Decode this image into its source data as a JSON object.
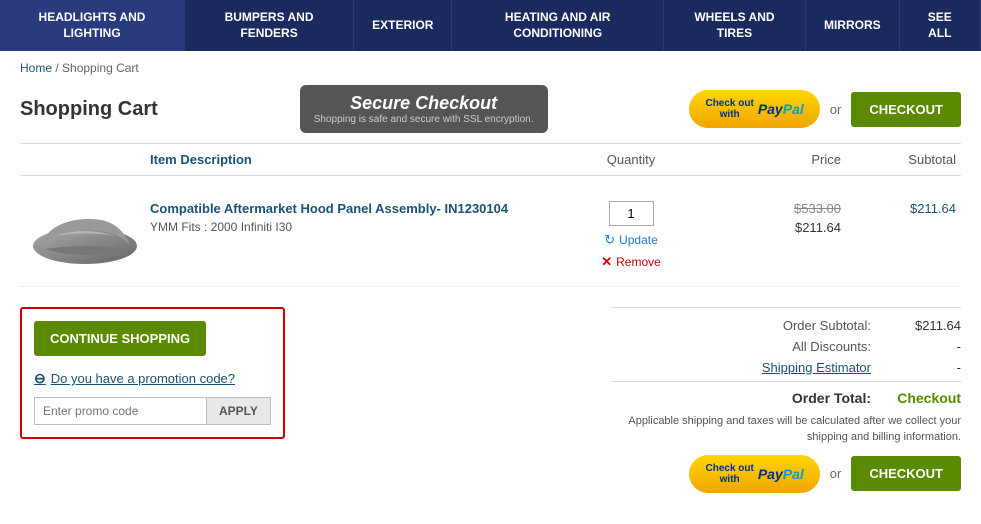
{
  "nav": {
    "items": [
      {
        "label": "HEADLIGHTS AND LIGHTING",
        "id": "headlights"
      },
      {
        "label": "BUMPERS AND FENDERS",
        "id": "bumpers"
      },
      {
        "label": "EXTERIOR",
        "id": "exterior"
      },
      {
        "label": "HEATING AND AIR CONDITIONING",
        "id": "heating"
      },
      {
        "label": "WHEELS AND TIRES",
        "id": "wheels"
      },
      {
        "label": "MIRRORS",
        "id": "mirrors"
      },
      {
        "label": "SEE ALL",
        "id": "see-all"
      }
    ]
  },
  "breadcrumb": {
    "home": "Home",
    "separator": "/",
    "current": "Shopping Cart"
  },
  "cart": {
    "title": "Shopping Cart",
    "secure_badge_title": "Secure Checkout",
    "secure_badge_sub": "Shopping is safe and secure with SSL encryption.",
    "paypal_label": "Check out with PayPal",
    "or_label": "or",
    "checkout_label": "CHECKOUT",
    "columns": {
      "description": "Item Description",
      "quantity": "Quantity",
      "price": "Price",
      "subtotal": "Subtotal"
    },
    "item": {
      "name": "Compatible Aftermarket Hood Panel Assembly- IN1230104",
      "ymm": "YMM Fits : 2000 Infiniti I30",
      "qty": "1",
      "price_original": "$533.00",
      "price_sale": "$211.64",
      "subtotal": "$211.64",
      "update_label": "Update",
      "remove_label": "Remove"
    }
  },
  "bottom": {
    "continue_shopping": "CONTINUE SHOPPING",
    "promo_link": "Do you have a promotion code?",
    "promo_placeholder": "Enter promo code",
    "apply_label": "APPLY",
    "order_subtotal_label": "Order Subtotal:",
    "order_subtotal_value": "$211.64",
    "all_discounts_label": "All Discounts:",
    "all_discounts_value": "-",
    "shipping_label": "Shipping Estimator",
    "shipping_value": "-",
    "order_total_label": "Order Total:",
    "order_total_value": "Checkout",
    "shipping_note": "Applicable shipping and taxes will be calculated after we collect your shipping and billing information.",
    "paypal_label2": "Check out with PayPal",
    "or_label2": "or",
    "checkout_label2": "CHECKOUT"
  }
}
